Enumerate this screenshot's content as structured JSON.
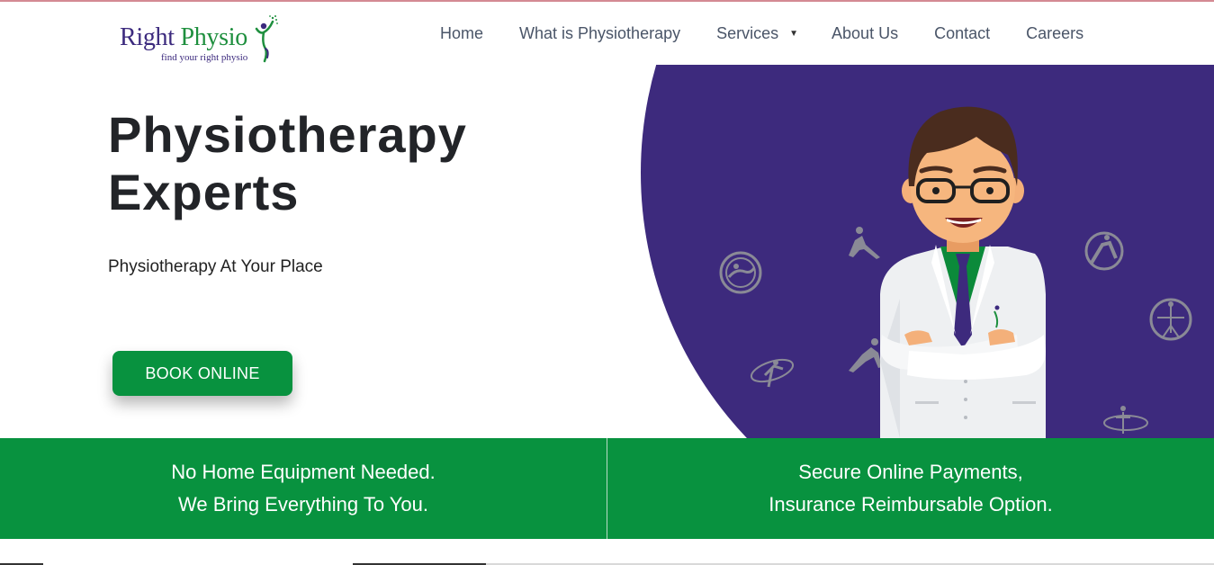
{
  "logo": {
    "word1": "Right",
    "word2": "Physio",
    "tagline": "find your right physio"
  },
  "nav": {
    "items": [
      {
        "label": "Home"
      },
      {
        "label": "What is Physiotherapy"
      },
      {
        "label": "Services"
      },
      {
        "label": "About Us"
      },
      {
        "label": "Contact"
      },
      {
        "label": "Careers"
      }
    ]
  },
  "hero": {
    "title_line1": "Physiotherapy",
    "title_line2": "Experts",
    "subtitle": "Physiotherapy At Your Place",
    "cta_label": "BOOK ONLINE"
  },
  "banner": {
    "left_line1": "No Home Equipment Needed.",
    "left_line2": "We Bring Everything To You.",
    "right_line1": "Secure Online Payments,",
    "right_line2": "Insurance Reimbursable Option."
  },
  "colors": {
    "brand_green": "#08923f",
    "brand_purple": "#3c2a7e",
    "hero_circle": "#3d2a7d",
    "nav_text": "#4a5568"
  }
}
